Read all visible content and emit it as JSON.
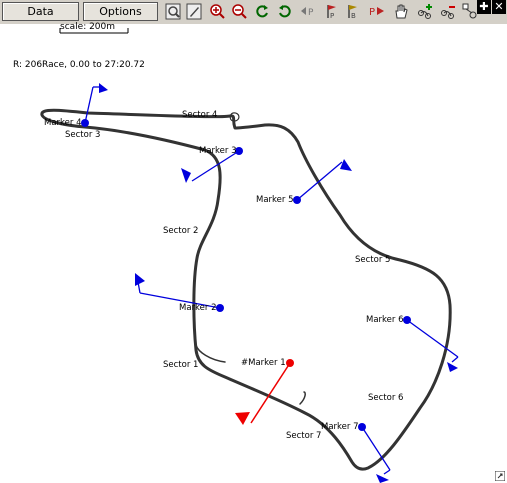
{
  "toolbar": {
    "data_label": "Data",
    "options_label": "Options",
    "icons": [
      "zoom-rect-icon",
      "edit-icon",
      "zoom-in-icon",
      "zoom-out-icon",
      "refresh-icon",
      "rotate-icon",
      "prev-marker-icon",
      "flag-marker-icon",
      "next-marker-icon",
      "pan-hand-icon",
      "add-point-icon",
      "remove-point-icon",
      "node-edit-icon",
      "move-icon",
      "close-icon"
    ]
  },
  "scale": {
    "label": "scale: 200m"
  },
  "route": {
    "info": "R: 206Race, 0.00 to 27:20.72"
  },
  "markers": {
    "m1": "#Marker 1",
    "m2": "Marker 2",
    "m3": "Marker 3",
    "m4": "Marker 4",
    "m5": "Marker 5",
    "m6": "Marker 6",
    "m7": "Marker 7"
  },
  "sectors": {
    "s1": "Sector 1",
    "s2": "Sector 2",
    "s3": "Sector 3",
    "s4": "Sector 4",
    "s5": "Sector 5",
    "s6": "Sector 6",
    "s7": "Sector 7"
  },
  "colors": {
    "marker_blue": "#0000dd",
    "marker_red": "#ee0000",
    "track": "#333333"
  }
}
